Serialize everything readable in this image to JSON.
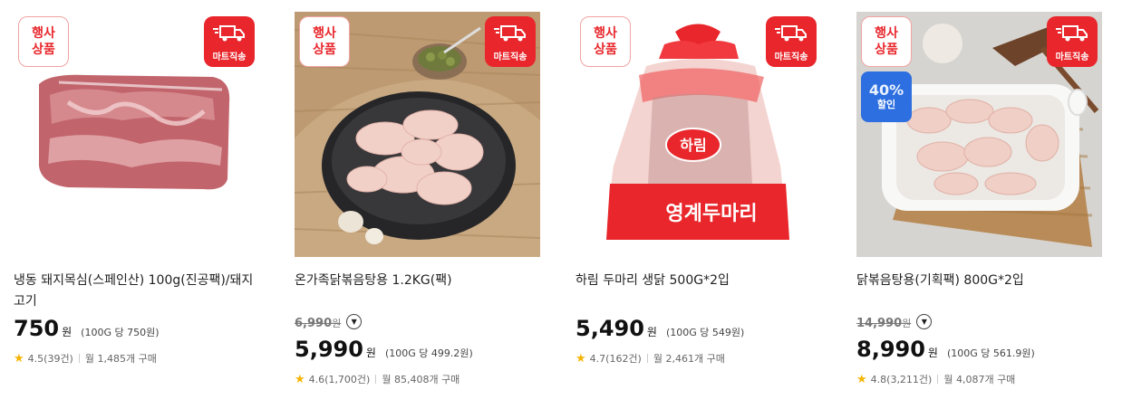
{
  "badges": {
    "event_line1": "행사",
    "event_line2": "상품",
    "mart_direct": "마트직송",
    "sale_percent": "40%",
    "sale_label": "할인"
  },
  "products": [
    {
      "title": "냉동 돼지목심(스페인산) 100g(진공팩)/돼지고기",
      "price": "750",
      "won": "원",
      "unit_price": "(100G 당 750원)",
      "rating": "4.5(39건)",
      "monthly": "월 1,485개 구매"
    },
    {
      "title": "온가족닭볶음탕용 1.2KG(팩)",
      "original_price": "6,990",
      "original_won": "원",
      "price": "5,990",
      "won": "원",
      "unit_price": "(100G 당 499.2원)",
      "rating": "4.6(1,700건)",
      "monthly": "월 85,408개 구매"
    },
    {
      "title": "하림 두마리 생닭 500G*2입",
      "price": "5,490",
      "won": "원",
      "unit_price": "(100G 당 549원)",
      "rating": "4.7(162건)",
      "monthly": "월 2,461개 구매",
      "package_brand": "하림",
      "package_name": "영계두마리"
    },
    {
      "title": "닭볶음탕용(기획팩) 800G*2입",
      "original_price": "14,990",
      "original_won": "원",
      "price": "8,990",
      "won": "원",
      "unit_price": "(100G 당 561.9원)",
      "rating": "4.8(3,211건)",
      "monthly": "월 4,087개 구매"
    }
  ],
  "icons": {
    "truck": "truck-icon",
    "star": "star-icon",
    "dropdown": "chevron-down-icon"
  },
  "colors": {
    "badge_red": "#e8262b",
    "sale_blue": "#2d6fe0",
    "star": "#f5b400"
  }
}
